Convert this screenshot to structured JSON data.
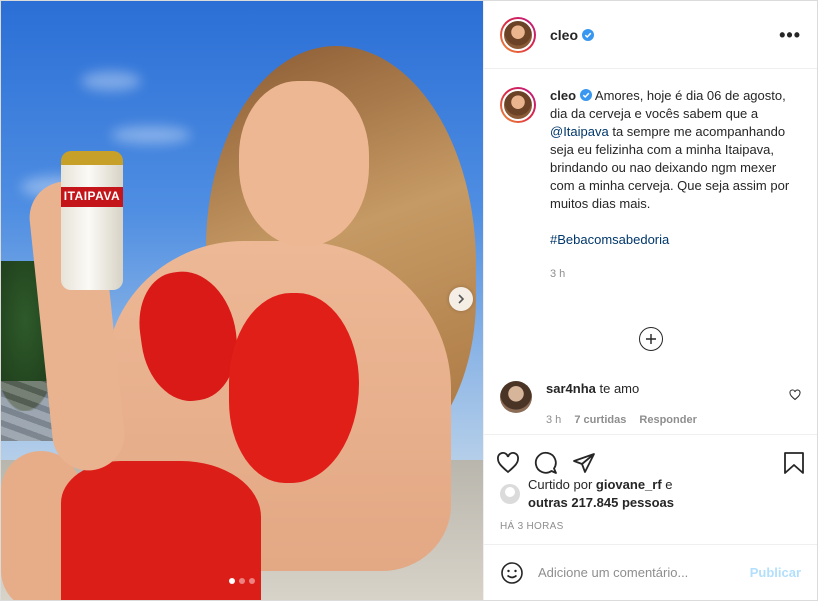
{
  "post": {
    "username": "cleo",
    "verified": true,
    "more_label": "•••"
  },
  "photo": {
    "can_brand": "ITAIPAVA",
    "carousel_dots": 3,
    "active_dot": 0
  },
  "caption": {
    "username": "cleo",
    "text_before_mention": "Amores, hoje é dia 06 de agosto, dia da cerveja e vocês sabem que a ",
    "mention": "@Itaipava",
    "text_after_mention": " ta sempre me acompanhando seja eu felizinha com a minha Itaipava, brindando ou nao deixando ngm mexer com a minha cerveja. Que seja assim por muitos dias mais.",
    "hashtag": "#Bebacomsabedoria",
    "time": "3 h"
  },
  "comment": {
    "username": "sar4nha",
    "text": "te amo",
    "time": "3 h",
    "likes": "7 curtidas",
    "reply": "Responder"
  },
  "likes": {
    "prefix": "Curtido por ",
    "user": "giovane_rf",
    "middle": " e ",
    "others": "outras 217.845 pessoas"
  },
  "posted_ago": "HÁ 3 HORAS",
  "add_comment": {
    "placeholder": "Adicione um comentário...",
    "publish": "Publicar"
  },
  "colors": {
    "verified": "#3897f0",
    "link": "#00376b",
    "publish_disabled": "#b2dffc",
    "bikini": "#e11f19"
  }
}
